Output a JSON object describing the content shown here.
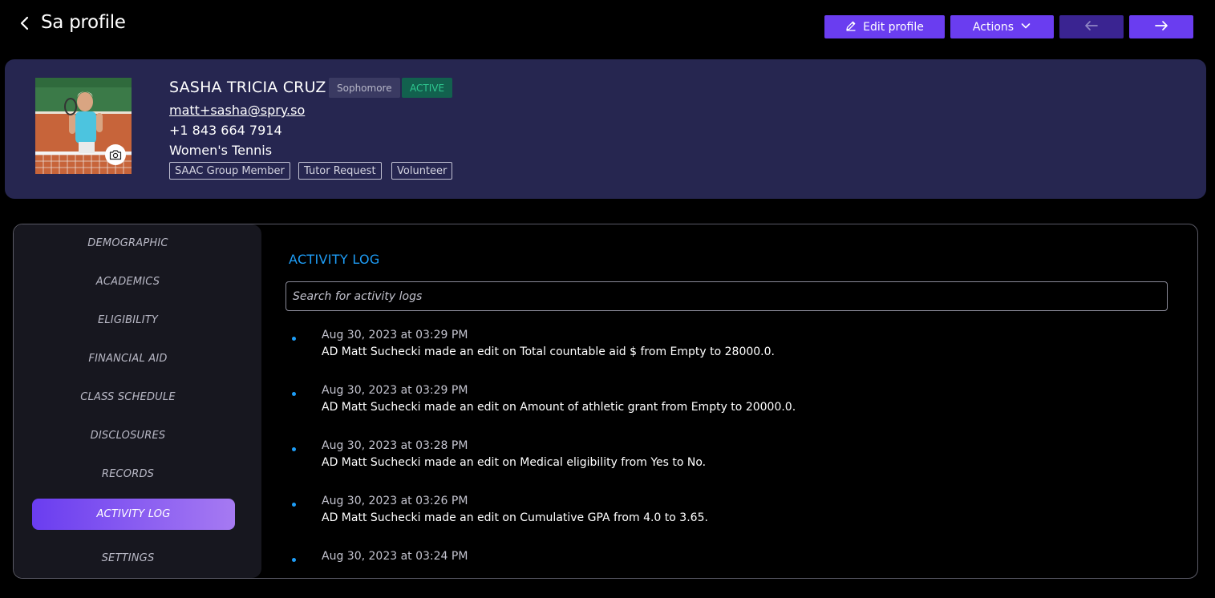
{
  "header": {
    "title": "Sa profile",
    "edit_label": "Edit profile",
    "actions_label": "Actions"
  },
  "profile": {
    "name": "SASHA TRICIA CRUZ",
    "class_year": "Sophomore",
    "status": "ACTIVE",
    "email": "matt+sasha@spry.so",
    "phone": "+1 843 664 7914",
    "team": "Women's Tennis",
    "tags": [
      "SAAC Group Member",
      "Tutor Request",
      "Volunteer"
    ]
  },
  "sidebar": {
    "items": [
      "DEMOGRAPHIC",
      "ACADEMICS",
      "ELIGIBILITY",
      "FINANCIAL AID",
      "CLASS SCHEDULE",
      "DISCLOSURES",
      "RECORDS",
      "ACTIVITY LOG",
      "SETTINGS"
    ],
    "active": "ACTIVITY LOG"
  },
  "activity": {
    "title": "ACTIVITY LOG",
    "search_placeholder": "Search for activity logs",
    "entries": [
      {
        "time": "Aug 30, 2023 at 03:29 PM",
        "text": "AD Matt Suchecki made an edit on Total countable aid $ from Empty to 28000.0."
      },
      {
        "time": "Aug 30, 2023 at 03:29 PM",
        "text": "AD Matt Suchecki made an edit on Amount of athletic grant from Empty to 20000.0."
      },
      {
        "time": "Aug 30, 2023 at 03:28 PM",
        "text": "AD Matt Suchecki made an edit on Medical eligibility from Yes to No."
      },
      {
        "time": "Aug 30, 2023 at 03:26 PM",
        "text": "AD Matt Suchecki made an edit on Cumulative GPA from 4.0 to 3.65."
      },
      {
        "time": "Aug 30, 2023 at 03:24 PM",
        "text": ""
      }
    ]
  },
  "colors": {
    "primary": "#6a3df0",
    "card_bg": "#262650",
    "accent_blue": "#1e9df6",
    "active_green": "#2ec68f"
  }
}
